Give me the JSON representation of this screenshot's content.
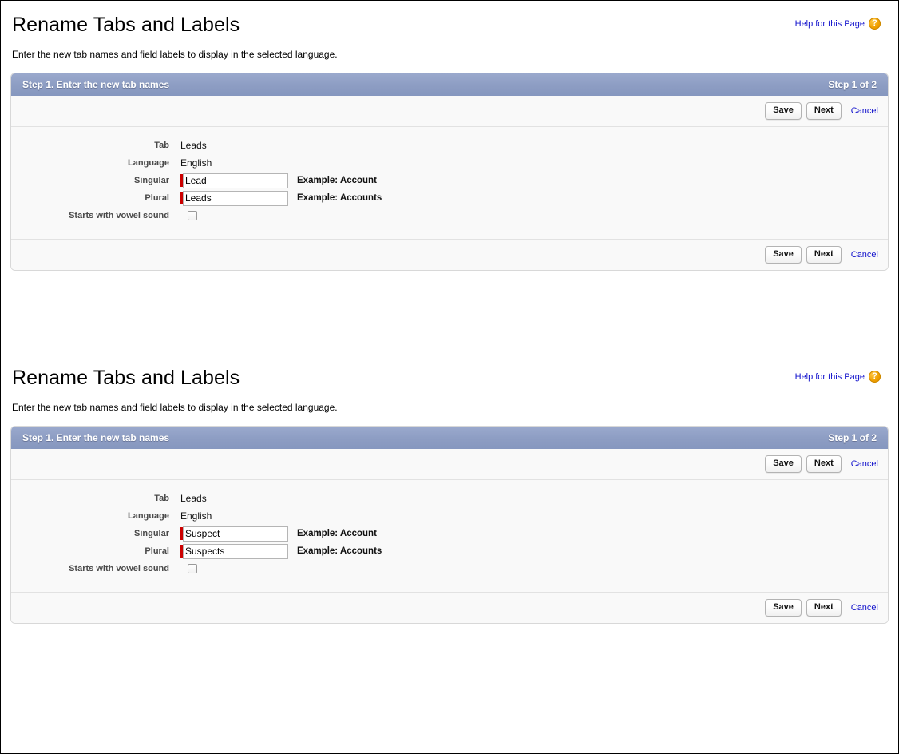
{
  "page": {
    "title": "Rename Tabs and Labels",
    "description": "Enter the new tab names and field labels to display in the selected language.",
    "help_link": "Help for this Page",
    "help_icon": "question-mark-icon"
  },
  "accent_colors": {
    "panel_header": "#8d9dc3",
    "link": "#1111cc",
    "required_mark": "#cc0000",
    "help_icon": "#f0a000",
    "panel_body": "#f9f9f9",
    "page_background": "#ffffff"
  },
  "panel": {
    "step_title": "Step 1. Enter the new tab names",
    "step_count": "Step 1 of 2",
    "buttons": {
      "save": "Save",
      "next": "Next",
      "cancel": "Cancel"
    },
    "labels": {
      "tab": "Tab",
      "language": "Language",
      "singular": "Singular",
      "plural": "Plural",
      "vowel": "Starts with vowel sound"
    },
    "examples": {
      "singular": "Example: Account",
      "plural": "Example: Accounts"
    }
  },
  "sections": [
    {
      "id": "section-one",
      "values": {
        "tab": "Leads",
        "language": "English",
        "singular": "Lead",
        "plural": "Leads",
        "vowel_checked": false
      }
    },
    {
      "id": "section-two",
      "values": {
        "tab": "Leads",
        "language": "English",
        "singular": "Suspect",
        "plural": "Suspects",
        "vowel_checked": false
      }
    }
  ]
}
